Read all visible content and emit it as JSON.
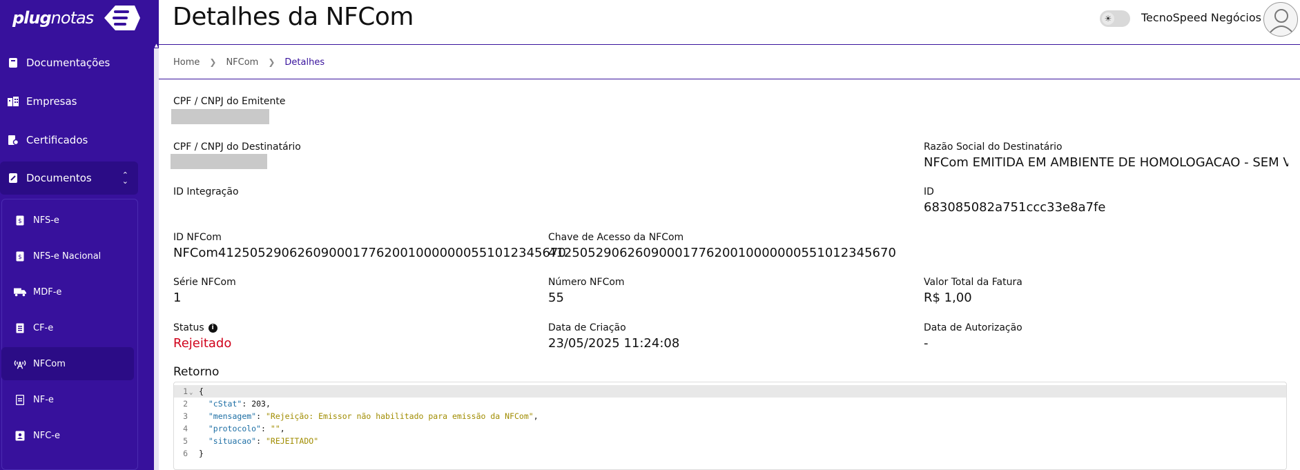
{
  "brand": {
    "name_bold": "plug",
    "name_light": "notas"
  },
  "sidebar": {
    "items": [
      {
        "label": "Documentações",
        "icon": "book-icon"
      },
      {
        "label": "Empresas",
        "icon": "buildings-icon"
      },
      {
        "label": "Certificados",
        "icon": "certificate-icon"
      },
      {
        "label": "Documentos",
        "icon": "documents-icon"
      }
    ],
    "sub_items": [
      {
        "label": "NFS-e",
        "icon": "file-dollar-icon"
      },
      {
        "label": "NFS-e Nacional",
        "icon": "file-dollar-icon"
      },
      {
        "label": "MDF-e",
        "icon": "truck-icon"
      },
      {
        "label": "CF-e",
        "icon": "receipt-icon"
      },
      {
        "label": "NFCom",
        "icon": "antenna-icon"
      },
      {
        "label": "NF-e",
        "icon": "file-text-icon"
      },
      {
        "label": "NFC-e",
        "icon": "id-card-icon"
      }
    ]
  },
  "header": {
    "title": "Detalhes da NFCom",
    "company": "TecnoSpeed Negócios"
  },
  "breadcrumb": {
    "home": "Home",
    "section": "NFCom",
    "current": "Detalhes"
  },
  "fields": {
    "emitente_label": "CPF / CNPJ do Emitente",
    "destinatario_label": "CPF / CNPJ do Destinatário",
    "razao_label": "Razão Social do Destinatário",
    "razao_value": "NFCom EMITIDA EM AMBIENTE DE HOMOLOGACAO - SEM VALOR",
    "id_integracao_label": "ID Integração",
    "id_label": "ID",
    "id_value": "683085082a751ccc33e8a7fe",
    "id_nfcom_label": "ID NFCom",
    "id_nfcom_value": "NFCom41250529062609000177620010000000551012345670",
    "chave_label": "Chave de Acesso da NFCom",
    "chave_value": "41250529062609000177620010000000551012345670",
    "serie_label": "Série NFCom",
    "serie_value": "1",
    "numero_label": "Número NFCom",
    "numero_value": "55",
    "valor_label": "Valor Total da Fatura",
    "valor_value": "R$ 1,00",
    "status_label": "Status",
    "status_value": "Rejeitado",
    "criacao_label": "Data de Criação",
    "criacao_value": "23/05/2025 11:24:08",
    "autorizacao_label": "Data de Autorização",
    "autorizacao_value": "-"
  },
  "retorno": {
    "label": "Retorno",
    "lines": [
      {
        "n": "1",
        "text": "{"
      },
      {
        "n": "2",
        "key": "\"cStat\"",
        "val": "203",
        "str": false
      },
      {
        "n": "3",
        "key": "\"mensagem\"",
        "val": "\"Rejeição: Emissor não habilitado para emissão da NFCom\"",
        "str": true
      },
      {
        "n": "4",
        "key": "\"protocolo\"",
        "val": "\"\"",
        "str": true
      },
      {
        "n": "5",
        "key": "\"situacao\"",
        "val": "\"REJEITADO\"",
        "str": true
      },
      {
        "n": "6",
        "text": "}"
      }
    ]
  },
  "colors": {
    "sidebar": "#37119c",
    "active": "#2b0c86",
    "rejected": "#d0021b"
  }
}
